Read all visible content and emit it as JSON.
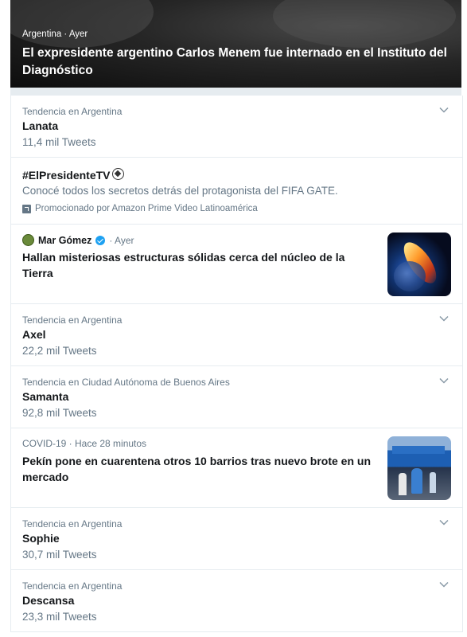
{
  "hero": {
    "meta": "Argentina · Ayer",
    "title": "El expresidente argentino Carlos Menem fue internado en el Instituto del Diagnóstico"
  },
  "feed": [
    {
      "kind": "trend",
      "context": "Tendencia en Argentina",
      "name": "Lanata",
      "count": "11,4 mil Tweets"
    },
    {
      "kind": "promo",
      "name": "#ElPresidenteTV",
      "description": "Conocé todos los secretos detrás del protagonista del FIFA GATE.",
      "ad_label": "Promocionado por Amazon Prime Video Latinoamérica"
    },
    {
      "kind": "story",
      "author": "Mar Gómez",
      "time": "· Ayer",
      "headline": "Hallan misteriosas estructuras sólidas cerca del núcleo de la Tierra",
      "thumb_icon": "earth-core-image"
    },
    {
      "kind": "trend",
      "context": "Tendencia en Argentina",
      "name": "Axel",
      "count": "22,2 mil Tweets"
    },
    {
      "kind": "trend",
      "context": "Tendencia en Ciudad Autónoma de Buenos Aires",
      "name": "Samanta",
      "count": "92,8 mil Tweets"
    },
    {
      "kind": "story",
      "meta": "COVID-19 · Hace 28 minutos",
      "headline": "Pekín pone en cuarentena otros 10 barrios tras nuevo brote en un mercado",
      "thumb_icon": "quarantine-tent-image"
    },
    {
      "kind": "trend",
      "context": "Tendencia en Argentina",
      "name": "Sophie",
      "count": "30,7 mil Tweets"
    },
    {
      "kind": "trend",
      "context": "Tendencia en Argentina",
      "name": "Descansa",
      "count": "23,3 mil Tweets"
    }
  ],
  "colors": {
    "text": "#14171a",
    "secondary": "#657786",
    "border": "#e6ecf0",
    "verified": "#1da1f2"
  }
}
